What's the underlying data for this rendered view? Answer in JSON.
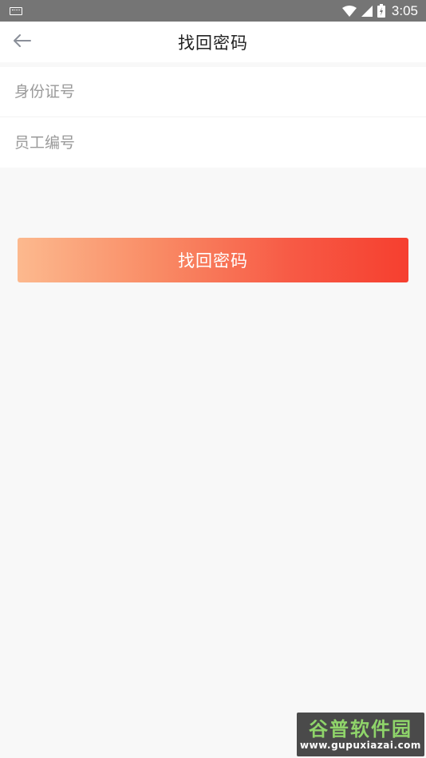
{
  "status_bar": {
    "time": "3:05",
    "icons": [
      "keyboard-icon",
      "wifi-icon",
      "signal-icon",
      "battery-icon"
    ]
  },
  "header": {
    "title": "找回密码",
    "back_icon": "arrow-left-icon"
  },
  "form": {
    "id_number_placeholder": "身份证号",
    "employee_id_placeholder": "员工编号"
  },
  "actions": {
    "submit_label": "找回密码"
  },
  "watermark": {
    "logo_text": "谷普软件园",
    "url": "www.gupuxiazai.com"
  },
  "colors": {
    "status_bar": "#757575",
    "button_gradient_start": "#fcb98e",
    "button_gradient_end": "#f63f2f",
    "background": "#f8f8f8"
  }
}
